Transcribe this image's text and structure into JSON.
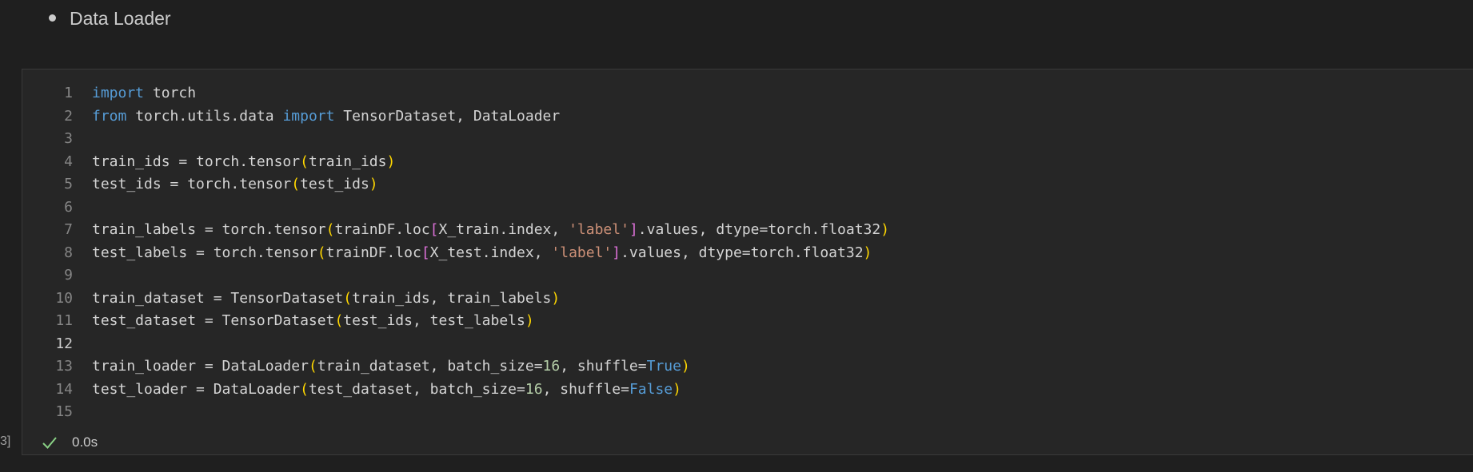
{
  "markdown_cell": {
    "bullet_text": "Data Loader"
  },
  "code_cell": {
    "execution_count": "3]",
    "lines": [
      {
        "n": "1",
        "tokens": [
          {
            "t": "import",
            "c": "kw"
          },
          {
            "t": " torch",
            "c": ""
          }
        ]
      },
      {
        "n": "2",
        "tokens": [
          {
            "t": "from",
            "c": "kw"
          },
          {
            "t": " torch.utils.data ",
            "c": ""
          },
          {
            "t": "import",
            "c": "kw"
          },
          {
            "t": " TensorDataset, DataLoader",
            "c": ""
          }
        ]
      },
      {
        "n": "3",
        "tokens": []
      },
      {
        "n": "4",
        "tokens": [
          {
            "t": "train_ids = torch.tensor",
            "c": ""
          },
          {
            "t": "(",
            "c": "p1"
          },
          {
            "t": "train_ids",
            "c": ""
          },
          {
            "t": ")",
            "c": "p1"
          }
        ]
      },
      {
        "n": "5",
        "tokens": [
          {
            "t": "test_ids = torch.tensor",
            "c": ""
          },
          {
            "t": "(",
            "c": "p1"
          },
          {
            "t": "test_ids",
            "c": ""
          },
          {
            "t": ")",
            "c": "p1"
          }
        ]
      },
      {
        "n": "6",
        "tokens": []
      },
      {
        "n": "7",
        "tokens": [
          {
            "t": "train_labels = torch.tensor",
            "c": ""
          },
          {
            "t": "(",
            "c": "p1"
          },
          {
            "t": "trainDF.loc",
            "c": ""
          },
          {
            "t": "[",
            "c": "p2"
          },
          {
            "t": "X_train.index, ",
            "c": ""
          },
          {
            "t": "'label'",
            "c": "str"
          },
          {
            "t": "]",
            "c": "p2"
          },
          {
            "t": ".values, dtype=torch.float32",
            "c": ""
          },
          {
            "t": ")",
            "c": "p1"
          }
        ]
      },
      {
        "n": "8",
        "tokens": [
          {
            "t": "test_labels = torch.tensor",
            "c": ""
          },
          {
            "t": "(",
            "c": "p1"
          },
          {
            "t": "trainDF.loc",
            "c": ""
          },
          {
            "t": "[",
            "c": "p2"
          },
          {
            "t": "X_test.index, ",
            "c": ""
          },
          {
            "t": "'label'",
            "c": "str"
          },
          {
            "t": "]",
            "c": "p2"
          },
          {
            "t": ".values, dtype=torch.float32",
            "c": ""
          },
          {
            "t": ")",
            "c": "p1"
          }
        ]
      },
      {
        "n": "9",
        "tokens": []
      },
      {
        "n": "10",
        "tokens": [
          {
            "t": "train_dataset = TensorDataset",
            "c": ""
          },
          {
            "t": "(",
            "c": "p1"
          },
          {
            "t": "train_ids, train_labels",
            "c": ""
          },
          {
            "t": ")",
            "c": "p1"
          }
        ]
      },
      {
        "n": "11",
        "tokens": [
          {
            "t": "test_dataset = TensorDataset",
            "c": ""
          },
          {
            "t": "(",
            "c": "p1"
          },
          {
            "t": "test_ids, test_labels",
            "c": ""
          },
          {
            "t": ")",
            "c": "p1"
          }
        ]
      },
      {
        "n": "12",
        "tokens": [],
        "active": true
      },
      {
        "n": "13",
        "tokens": [
          {
            "t": "train_loader = DataLoader",
            "c": ""
          },
          {
            "t": "(",
            "c": "p1"
          },
          {
            "t": "train_dataset, batch_size=",
            "c": ""
          },
          {
            "t": "16",
            "c": "num"
          },
          {
            "t": ", shuffle=",
            "c": ""
          },
          {
            "t": "True",
            "c": "cf"
          },
          {
            "t": ")",
            "c": "p1"
          }
        ]
      },
      {
        "n": "14",
        "tokens": [
          {
            "t": "test_loader = DataLoader",
            "c": ""
          },
          {
            "t": "(",
            "c": "p1"
          },
          {
            "t": "test_dataset, batch_size=",
            "c": ""
          },
          {
            "t": "16",
            "c": "num"
          },
          {
            "t": ", shuffle=",
            "c": ""
          },
          {
            "t": "False",
            "c": "cf"
          },
          {
            "t": ")",
            "c": "p1"
          }
        ]
      },
      {
        "n": "15",
        "tokens": []
      }
    ],
    "status": {
      "icon": "check-icon",
      "time": "0.0s",
      "color": "#89d185"
    }
  },
  "colors": {
    "background": "#1f1f1f",
    "cell_background": "#262626",
    "keyword": "#569cd6",
    "bracket_level1": "#ffd700",
    "bracket_level2": "#da70d6",
    "string": "#ce9178",
    "number": "#b5cea8"
  }
}
